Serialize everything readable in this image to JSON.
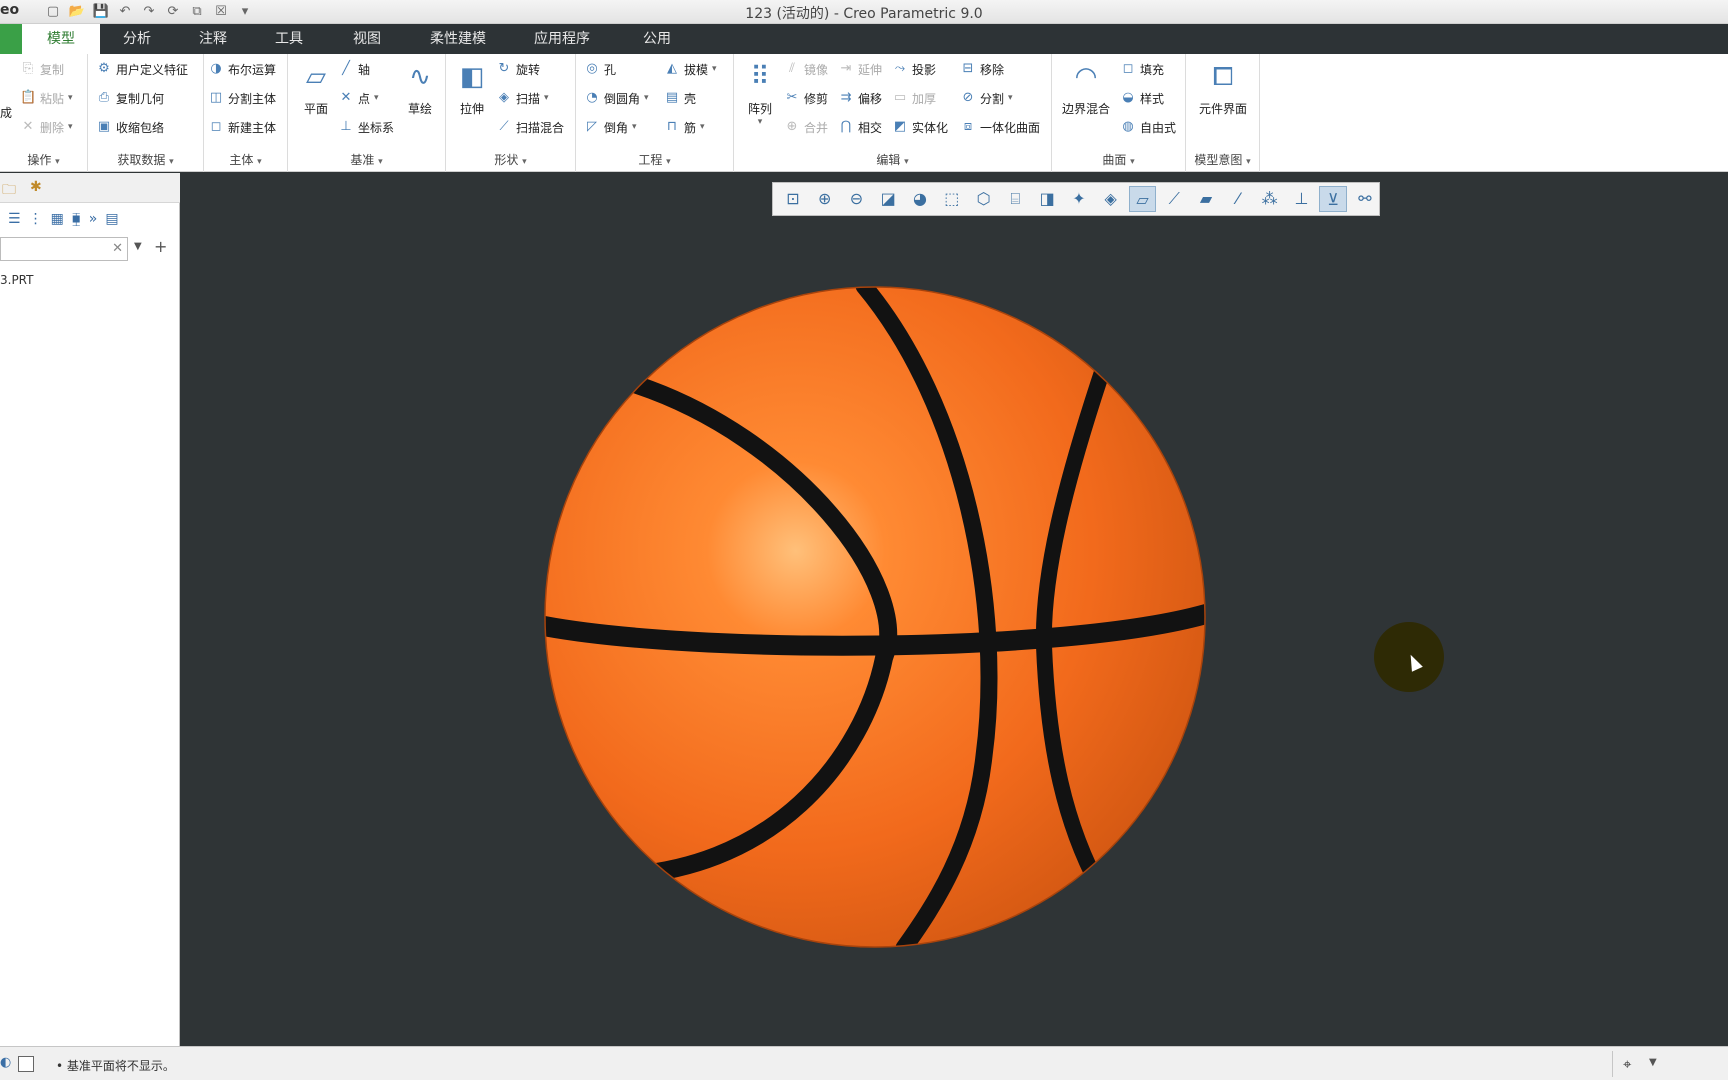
{
  "window": {
    "logo": "eo",
    "title": "123 (活动的) - Creo Parametric 9.0"
  },
  "tabs": [
    {
      "label": "模型",
      "active": true
    },
    {
      "label": "分析"
    },
    {
      "label": "注释"
    },
    {
      "label": "工具"
    },
    {
      "label": "视图"
    },
    {
      "label": "柔性建模"
    },
    {
      "label": "应用程序"
    },
    {
      "label": "公用"
    }
  ],
  "ribbon": {
    "operations": {
      "label": "操作",
      "copy": "复制",
      "paste": "粘贴",
      "delete": "删除",
      "regen": "成"
    },
    "get_data": {
      "label": "获取数据",
      "udf": "用户定义特征",
      "copy_geom": "复制几何",
      "shrinkwrap": "收缩包络"
    },
    "body": {
      "label": "主体",
      "boolean": "布尔运算",
      "split": "分割主体",
      "new": "新建主体"
    },
    "datum": {
      "label": "基准",
      "plane": "平面",
      "axis": "轴",
      "point": "点",
      "csys": "坐标系",
      "sketch": "草绘"
    },
    "shapes": {
      "label": "形状",
      "extrude": "拉伸",
      "revolve": "旋转",
      "sweep": "扫描",
      "swept_blend": "扫描混合"
    },
    "engineering": {
      "label": "工程",
      "hole": "孔",
      "round": "倒圆角",
      "chamfer": "倒角",
      "draft": "拔模",
      "shell": "壳",
      "rib": "筋"
    },
    "editing": {
      "label": "编辑",
      "pattern": "阵列",
      "mirror": "镜像",
      "extend": "延伸",
      "project": "投影",
      "remove": "移除",
      "trim": "修剪",
      "offset": "偏移",
      "thicken": "加厚",
      "split": "分割",
      "merge": "合并",
      "intersect": "相交",
      "solidify": "实体化",
      "unify": "一体化曲面"
    },
    "surfaces": {
      "label": "曲面",
      "boundary": "边界混合",
      "fill": "填充",
      "style": "样式",
      "freestyle": "自由式"
    },
    "intent": {
      "label": "模型意图",
      "component_interface": "元件界面"
    }
  },
  "left_panel": {
    "tree_item": "3.PRT"
  },
  "status": {
    "message": "基准平面将不显示。"
  },
  "colors": {
    "ball": "#f26a1c",
    "seam": "#121212",
    "viewport_bg": "#2f3436",
    "accent": "#3aa047"
  }
}
